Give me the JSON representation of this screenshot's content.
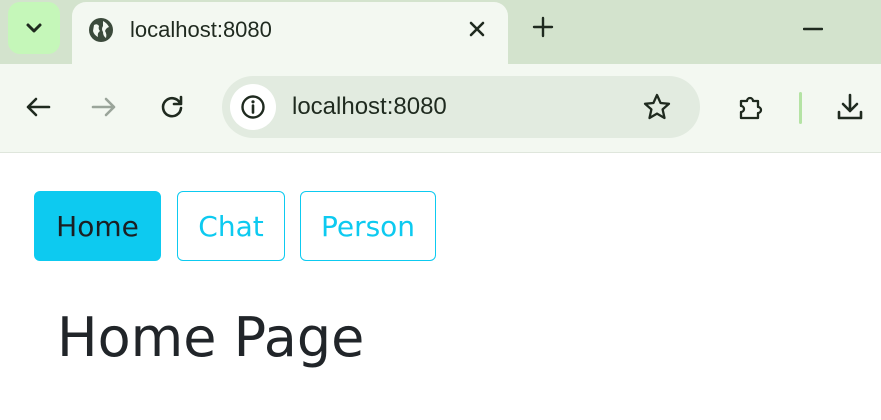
{
  "browser": {
    "tab": {
      "title": "localhost:8080",
      "favicon": "globe-icon"
    },
    "address_bar": {
      "url": "localhost:8080"
    },
    "icons": {
      "tab_search": "chevron-down-icon",
      "close": "close-icon",
      "new_tab": "plus-icon",
      "minimize": "minimize-icon",
      "back": "back-arrow-icon",
      "forward": "forward-arrow-icon",
      "reload": "reload-icon",
      "site_info": "info-icon",
      "bookmark": "star-icon",
      "extensions": "puzzle-icon",
      "download": "download-icon"
    }
  },
  "nav": {
    "items": [
      {
        "label": "Home",
        "active": true
      },
      {
        "label": "Chat",
        "active": false
      },
      {
        "label": "Person",
        "active": false
      }
    ]
  },
  "page": {
    "title": "Home Page"
  },
  "colors": {
    "accent": "#0dcaf0",
    "tabstrip": "#d3e3cd",
    "toolbar": "#f3f8f1",
    "text": "#212529"
  }
}
